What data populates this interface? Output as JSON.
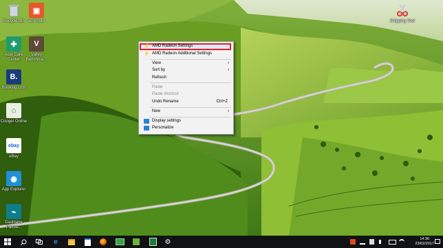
{
  "desktop_icons": [
    {
      "label": "Recycle Bin",
      "icon": "recycle-bin-icon"
    },
    {
      "label": "acrPhoto",
      "icon": "photo-app-icon"
    },
    {
      "label": "Acer Care Center",
      "icon": "acer-care-center-icon"
    },
    {
      "label": "Valley Benchma...",
      "icon": "valley-benchmark-icon"
    },
    {
      "label": "Booking.com",
      "icon": "booking-icon"
    },
    {
      "label": "Cooget Online",
      "icon": "cooget-online-icon"
    },
    {
      "label": "eBay",
      "icon": "ebay-icon"
    },
    {
      "label": "App Explorer",
      "icon": "app-explorer-icon"
    },
    {
      "label": "Dashlane Passw...",
      "icon": "dashlane-icon"
    },
    {
      "label": "Snipping Tool",
      "icon": "snipping-tool-icon"
    }
  ],
  "context_menu": {
    "items": [
      {
        "label": "AMD Radeon Settings",
        "icon": "amd-radeon-icon",
        "highlighted": true
      },
      {
        "label": "AMD Radeon Additional Settings",
        "icon": "amd-radeon-icon"
      },
      {
        "label": "View",
        "submenu": true
      },
      {
        "label": "Sort by",
        "submenu": true
      },
      {
        "label": "Refresh"
      },
      {
        "label": "Paste",
        "disabled": true
      },
      {
        "label": "Paste shortcut",
        "disabled": true
      },
      {
        "label": "Undo Rename",
        "shortcut": "Ctrl+Z"
      },
      {
        "label": "New",
        "submenu": true
      },
      {
        "label": "Display settings",
        "icon": "display-settings-icon"
      },
      {
        "label": "Personalize",
        "icon": "personalize-icon"
      }
    ]
  },
  "taskbar": {
    "apps": [
      "windows-start-icon",
      "search-icon",
      "task-view-icon",
      "edge-icon",
      "file-explorer-icon",
      "store-icon",
      "firefox-icon",
      "photos-icon",
      "acer-app-icon",
      "solitaire-icon",
      "settings-icon"
    ],
    "tray_icons": [
      "office-icon",
      "network-icon",
      "notification-icon",
      "volume-icon",
      "battery-icon",
      "action-center-icon"
    ],
    "clock_time": "14:36",
    "clock_date": "23/02/2017"
  },
  "colors": {
    "highlight_border": "#e3212b",
    "menu_bg": "#f2f2f2",
    "taskbar_bg": "#101214",
    "amd_red": "#e3212b"
  }
}
